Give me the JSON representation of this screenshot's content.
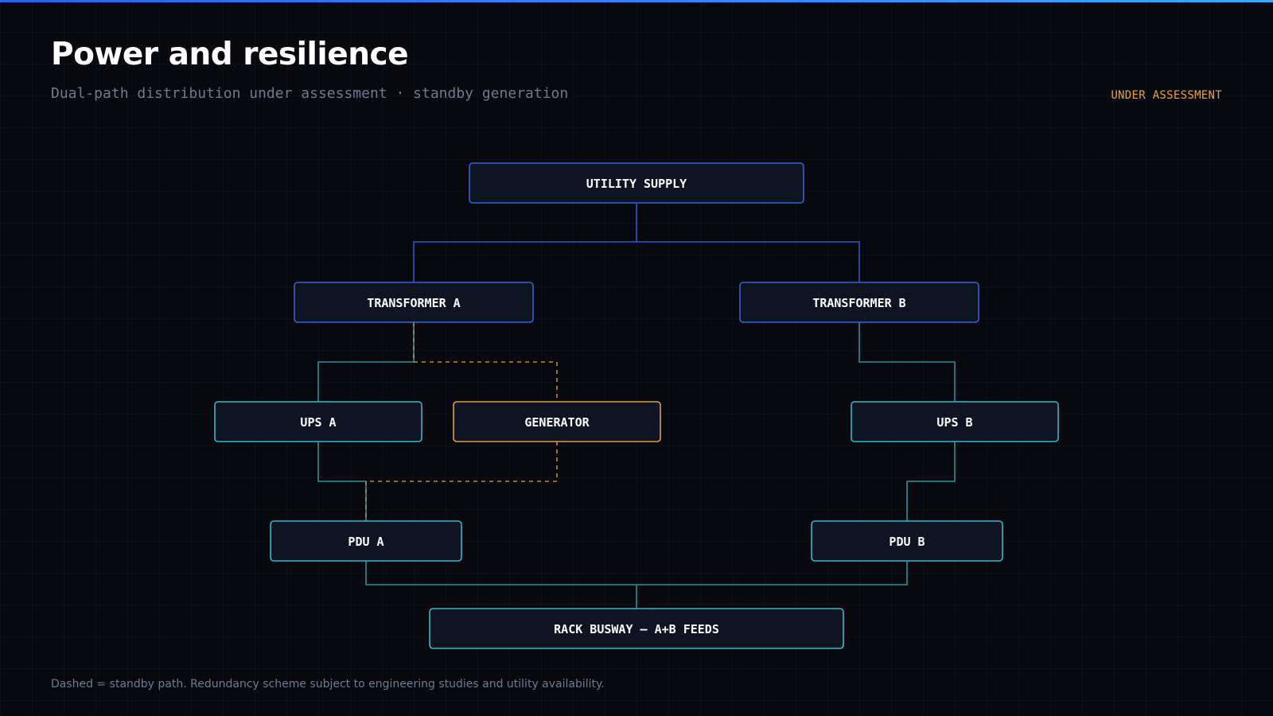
{
  "header": {
    "title": "Power and resilience",
    "subtitle": "Dual-path distribution under assessment · standby generation",
    "status": "UNDER ASSESSMENT"
  },
  "nodes": {
    "utility": "UTILITY SUPPLY",
    "transformer_a": "TRANSFORMER A",
    "transformer_b": "TRANSFORMER B",
    "ups_a": "UPS A",
    "generator": "GENERATOR",
    "ups_b": "UPS B",
    "pdu_a": "PDU A",
    "pdu_b": "PDU B",
    "busway": "RACK BUSWAY — A+B FEEDS"
  },
  "footer": {
    "note": "Dashed = standby path. Redundancy scheme subject to engineering studies and utility availability."
  },
  "colors": {
    "background": "#07090e",
    "primary_path": "#3562d8",
    "distribution_path": "#38b6c9",
    "standby": "#e0a03d"
  }
}
